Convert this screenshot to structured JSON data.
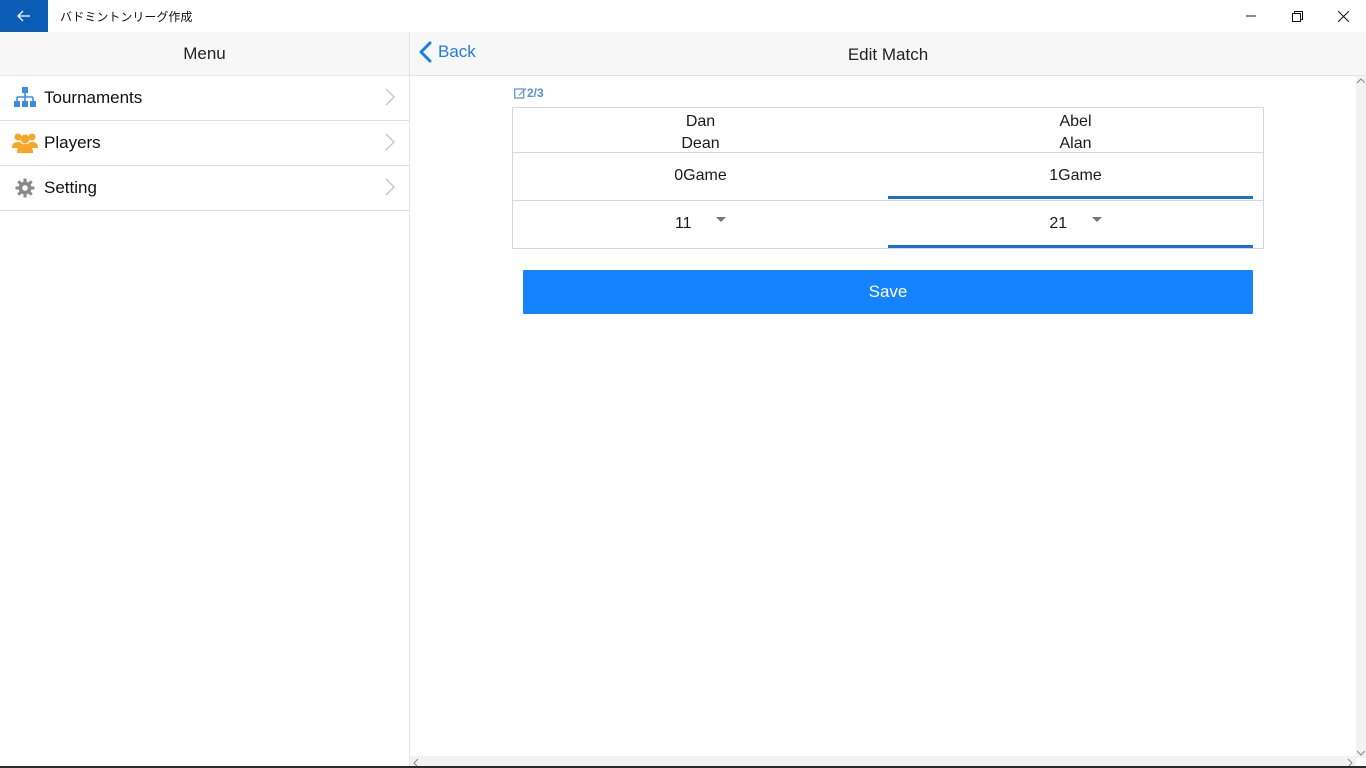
{
  "window": {
    "title": "バドミントンリーグ作成"
  },
  "menu": {
    "header": "Menu",
    "items": [
      {
        "label": "Tournaments",
        "icon": "sitemap-icon"
      },
      {
        "label": "Players",
        "icon": "users-icon"
      },
      {
        "label": "Setting",
        "icon": "gear-icon"
      }
    ]
  },
  "nav": {
    "back_label": "Back",
    "title": "Edit Match"
  },
  "match": {
    "label": "2/3",
    "team_left": {
      "player1": "Dan",
      "player2": "Dean",
      "games": "0Game",
      "score": "11"
    },
    "team_right": {
      "player1": "Abel",
      "player2": "Alan",
      "games": "1Game",
      "score": "21"
    },
    "selected_side": "right"
  },
  "save_label": "Save",
  "colors": {
    "accent": "#1583ff",
    "titlebar_back": "#0a5cb5",
    "link": "#1a7ee8",
    "underline": "#1a6fd6"
  }
}
